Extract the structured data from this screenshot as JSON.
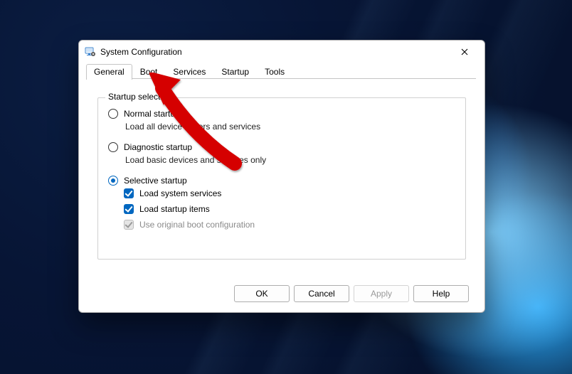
{
  "window": {
    "title": "System Configuration"
  },
  "tabs": [
    {
      "label": "General",
      "active": true
    },
    {
      "label": "Boot",
      "active": false
    },
    {
      "label": "Services",
      "active": false
    },
    {
      "label": "Startup",
      "active": false
    },
    {
      "label": "Tools",
      "active": false
    }
  ],
  "group": {
    "legend": "Startup selection",
    "options": [
      {
        "label": "Normal startup",
        "desc": "Load all device drivers and services",
        "selected": false
      },
      {
        "label": "Diagnostic startup",
        "desc": "Load basic devices and services only",
        "selected": false
      },
      {
        "label": "Selective startup",
        "selected": true,
        "checks": [
          {
            "label": "Load system services",
            "checked": true,
            "disabled": false
          },
          {
            "label": "Load startup items",
            "checked": true,
            "disabled": false
          },
          {
            "label": "Use original boot configuration",
            "checked": true,
            "disabled": true
          }
        ]
      }
    ]
  },
  "buttons": {
    "ok": "OK",
    "cancel": "Cancel",
    "apply": "Apply",
    "help": "Help"
  },
  "icons": {
    "app": "monitor-gear-icon",
    "close": "close-icon"
  },
  "annotation": {
    "arrow_target": "tab-boot"
  }
}
